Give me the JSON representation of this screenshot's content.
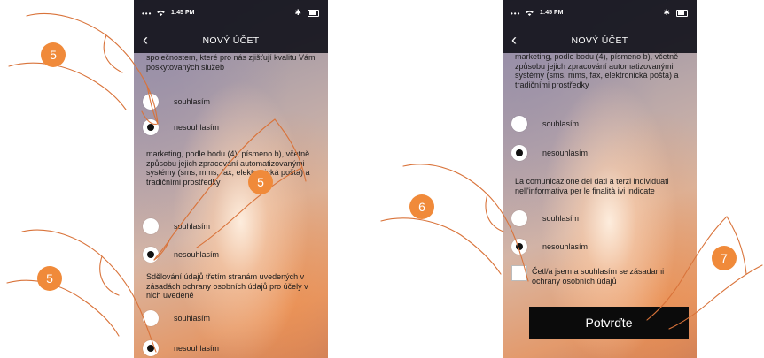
{
  "status": {
    "time": "1:45 PM"
  },
  "nav": {
    "title": "NOVÝ ÚČET"
  },
  "left": {
    "para1": "společnostem, které pro nás zjišťují kvalitu Vám poskytovaných služeb",
    "para2": "marketing, podle bodu (4), písmeno b), včetně způsobu jejich zpracování automatizovanými systémy (sms, mms, fax, elektronická pošta) a tradičními prostředky",
    "para3": "Sdělování údajů třetím stranám uvedených v zásadách ochrany osobních údajů pro účely v nich uvedené",
    "agree": "souhlasím",
    "disagree": "nesouhlasím"
  },
  "right": {
    "para1": "marketing, podle bodu (4), písmeno b), včetně způsobu jejich zpracování automatizovanými systémy (sms, mms, fax, elektronická pošta) a tradičními prostředky",
    "para2": "La comunicazione dei dati a terzi individuati nell'informativa per le finalità ivi indicate",
    "agree": "souhlasím",
    "disagree": "nesouhlasím",
    "checkbox_label": "Četl/a jsem a souhlasím se zásadami ochrany osobních údajů",
    "confirm": "Potvrďte"
  },
  "steps": {
    "five": "5",
    "six": "6",
    "seven": "7"
  },
  "colors": {
    "bar": "#14141c",
    "step_badge": "#f08a3a",
    "button": "#0b0b0b"
  }
}
